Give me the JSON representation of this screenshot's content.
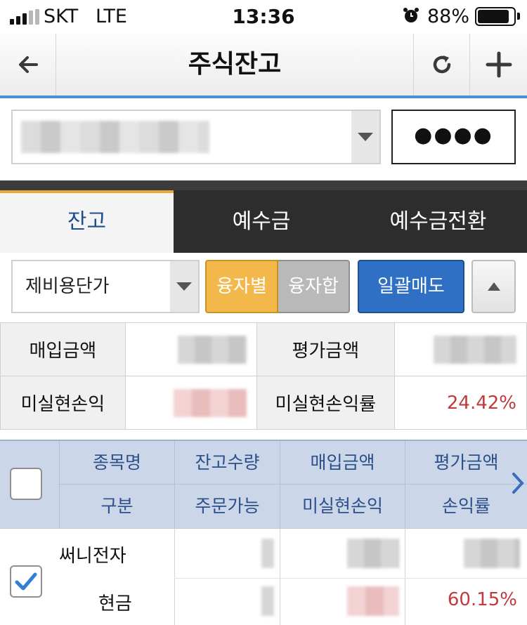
{
  "status_bar": {
    "carrier": "SKT",
    "network": "LTE",
    "time": "13:36",
    "battery_pct": "88%",
    "battery_level": 0.88
  },
  "nav": {
    "title": "주식잔고",
    "icons": [
      "back-arrow-icon",
      "refresh-icon",
      "plus-icon"
    ]
  },
  "account": {
    "password_mask": "●●●●"
  },
  "tabs": [
    {
      "label": "잔고",
      "active": true
    },
    {
      "label": "예수금",
      "active": false
    },
    {
      "label": "예수금전환",
      "active": false
    }
  ],
  "controls": {
    "price_mode": "제비용단가",
    "seg_on": "융자별",
    "seg_off": "융자합",
    "sell_all": "일괄매도"
  },
  "summary": {
    "purchase_label": "매입금액",
    "eval_label": "평가금액",
    "unrealized_label": "미실현손익",
    "unrealized_rate_label": "미실현손익률",
    "unrealized_rate": "24.42%"
  },
  "grid": {
    "header_row1": [
      "종목명",
      "잔고수량",
      "매입금액",
      "평가금액"
    ],
    "header_row2": [
      "구분",
      "주문가능",
      "미실현손익",
      "손익률"
    ],
    "rows": [
      {
        "name": "써니전자",
        "type": "현금",
        "rate": "60.15%",
        "checked": true
      }
    ]
  },
  "colors": {
    "accent_blue": "#2f6fc4",
    "tab_underline": "#e9a838",
    "seg_on": "#f2b84b",
    "profit_red": "#c23a3a",
    "grid_header": "#cbd6e8"
  }
}
